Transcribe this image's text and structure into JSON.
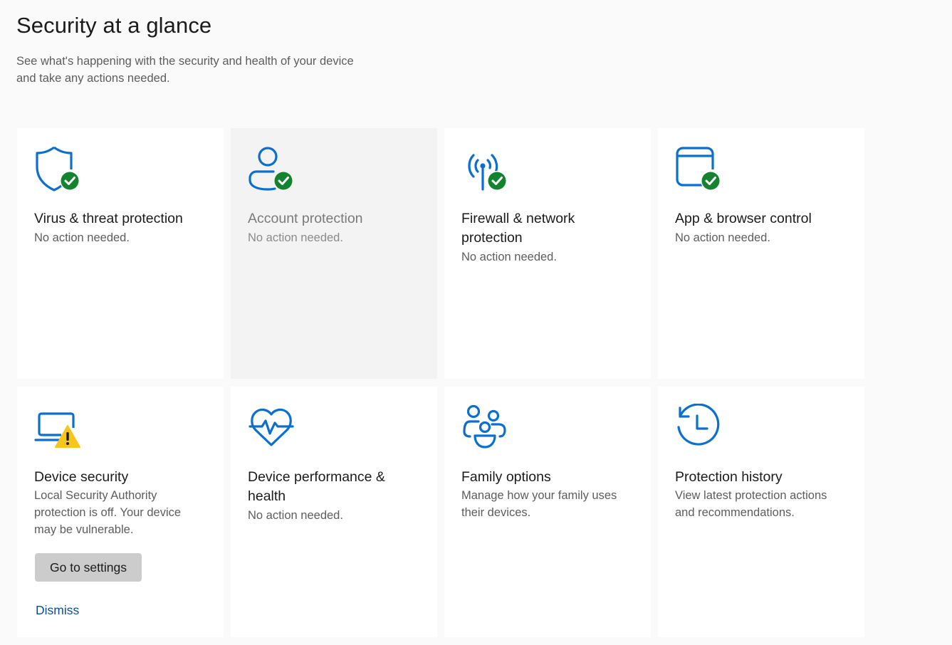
{
  "header": {
    "title": "Security at a glance",
    "subtitle": "See what's happening with the security and health of your device and take any actions needed."
  },
  "colors": {
    "accent": "#0b6fd1",
    "ok": "#14832f",
    "warning": "#f8c51b",
    "link": "#0b4f9c",
    "button": "#cccccc"
  },
  "tiles": [
    {
      "name": "Virus & threat protection",
      "status": "No action needed.",
      "icon": "shield-check-icon",
      "badge": "ok"
    },
    {
      "name": "Account protection",
      "status": "No action needed.",
      "icon": "person-check-icon",
      "badge": "ok",
      "state": "hover"
    },
    {
      "name": "Firewall & network protection",
      "status": "No action needed.",
      "icon": "antenna-check-icon",
      "badge": "ok"
    },
    {
      "name": "App & browser control",
      "status": "No action needed.",
      "icon": "browser-window-check-icon",
      "badge": "ok"
    },
    {
      "name": "Device security",
      "status": "Local Security Authority protection is off. Your device may be vulnerable.",
      "icon": "laptop-warning-icon",
      "badge": "warning",
      "action_button": "Go to settings",
      "action_link": "Dismiss"
    },
    {
      "name": "Device performance & health",
      "status": "No action needed.",
      "icon": "heart-pulse-icon"
    },
    {
      "name": "Family options",
      "status": "Manage how your family uses their devices.",
      "icon": "family-icon"
    },
    {
      "name": "Protection history",
      "status": "View latest protection actions and recommendations.",
      "icon": "history-clock-icon"
    }
  ]
}
